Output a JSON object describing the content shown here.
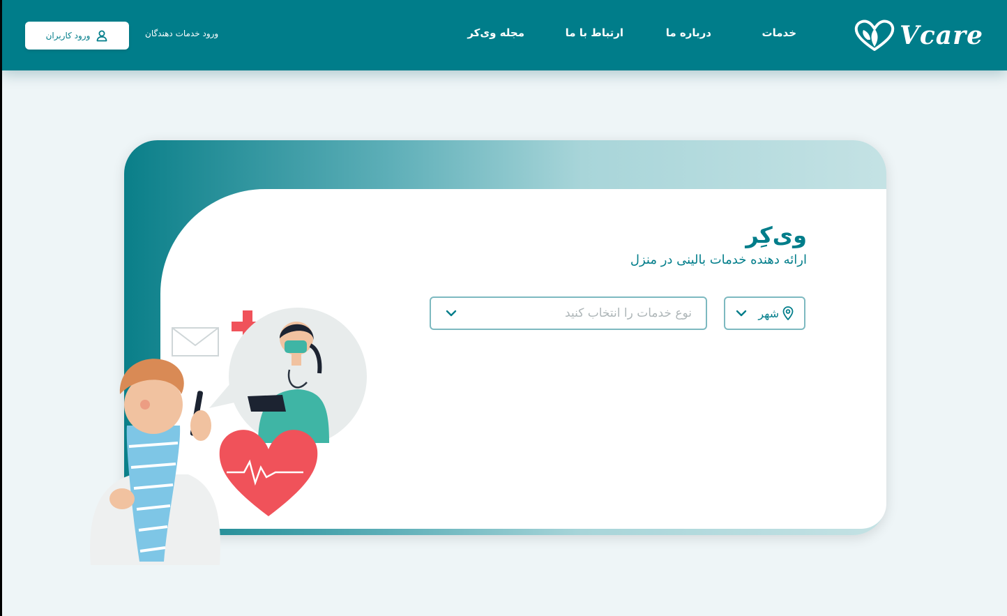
{
  "header": {
    "logo_text": "Vcare",
    "nav": {
      "services": "خدمات",
      "about": "درباره ما",
      "contact": "ارتباط با ما",
      "magazine": "مجله وی‌کر"
    },
    "provider_login": "ورود خدمات دهندگان",
    "user_login": "ورود کاربران"
  },
  "hero": {
    "title": "وی‌کِر",
    "subtitle": "ارائه دهنده خدمات بالینی در منزل"
  },
  "search": {
    "city_label": "شهر",
    "service_placeholder": "نوع خدمات را انتخاب کنید"
  },
  "colors": {
    "brand": "#007d8a",
    "background": "#eef5f7",
    "heart": "#f0525a"
  },
  "icons": {
    "logo": "heart-leaf-icon",
    "user": "user-icon",
    "location": "location-pin-icon",
    "chevron": "chevron-down-icon"
  }
}
